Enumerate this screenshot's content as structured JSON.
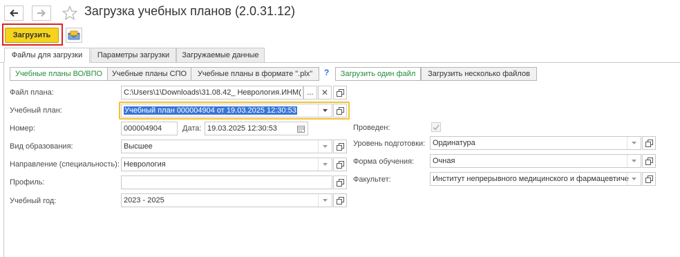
{
  "window": {
    "title": "Загрузка учебных планов (2.0.31.12)"
  },
  "toolbar": {
    "load_label": "Загрузить"
  },
  "tabs": [
    {
      "label": "Файлы для загрузки"
    },
    {
      "label": "Параметры загрузки"
    },
    {
      "label": "Загружаемые данные"
    }
  ],
  "segments": [
    {
      "label": "Учебные планы ВО/ВПО"
    },
    {
      "label": "Учебные планы СПО"
    },
    {
      "label": "Учебные планы в формате \".plx\""
    }
  ],
  "help": "?",
  "actions": [
    {
      "label": "Загрузить один файл"
    },
    {
      "label": "Загрузить несколько файлов"
    }
  ],
  "form": {
    "file_plan": {
      "label": "Файл плана:",
      "value": "C:\\Users\\1\\Downloads\\31.08.42_ Неврология.ИНМ(",
      "more": "..."
    },
    "curriculum": {
      "label": "Учебный план:",
      "value": "Учебный план 000004904 от 19.03.2025 12:30:53"
    },
    "number": {
      "label": "Номер:",
      "value": "000004904"
    },
    "date": {
      "label": "Дата:",
      "value": "19.03.2025 12:30:53"
    },
    "edu_type": {
      "label": "Вид образования:",
      "value": "Высшее"
    },
    "direction": {
      "label": "Направление (специальность):",
      "value": "Неврология"
    },
    "profile": {
      "label": "Профиль:",
      "value": ""
    },
    "year": {
      "label": "Учебный год:",
      "value": "2023 - 2025"
    },
    "posted": {
      "label": "Проведен:",
      "checked": true
    },
    "level": {
      "label": "Уровень подготовки:",
      "value": "Ординатура"
    },
    "form_type": {
      "label": "Форма обучения:",
      "value": "Очная"
    },
    "faculty": {
      "label": "Факультет:",
      "value": "Институт непрерывного медицинского и фармацевтиче"
    }
  },
  "colors": {
    "accent_button": "#f6d31c",
    "highlight_frame": "#e02020",
    "focus": "#f2c12e",
    "selection": "#3875d7",
    "green_text": "#1f8a3a"
  }
}
